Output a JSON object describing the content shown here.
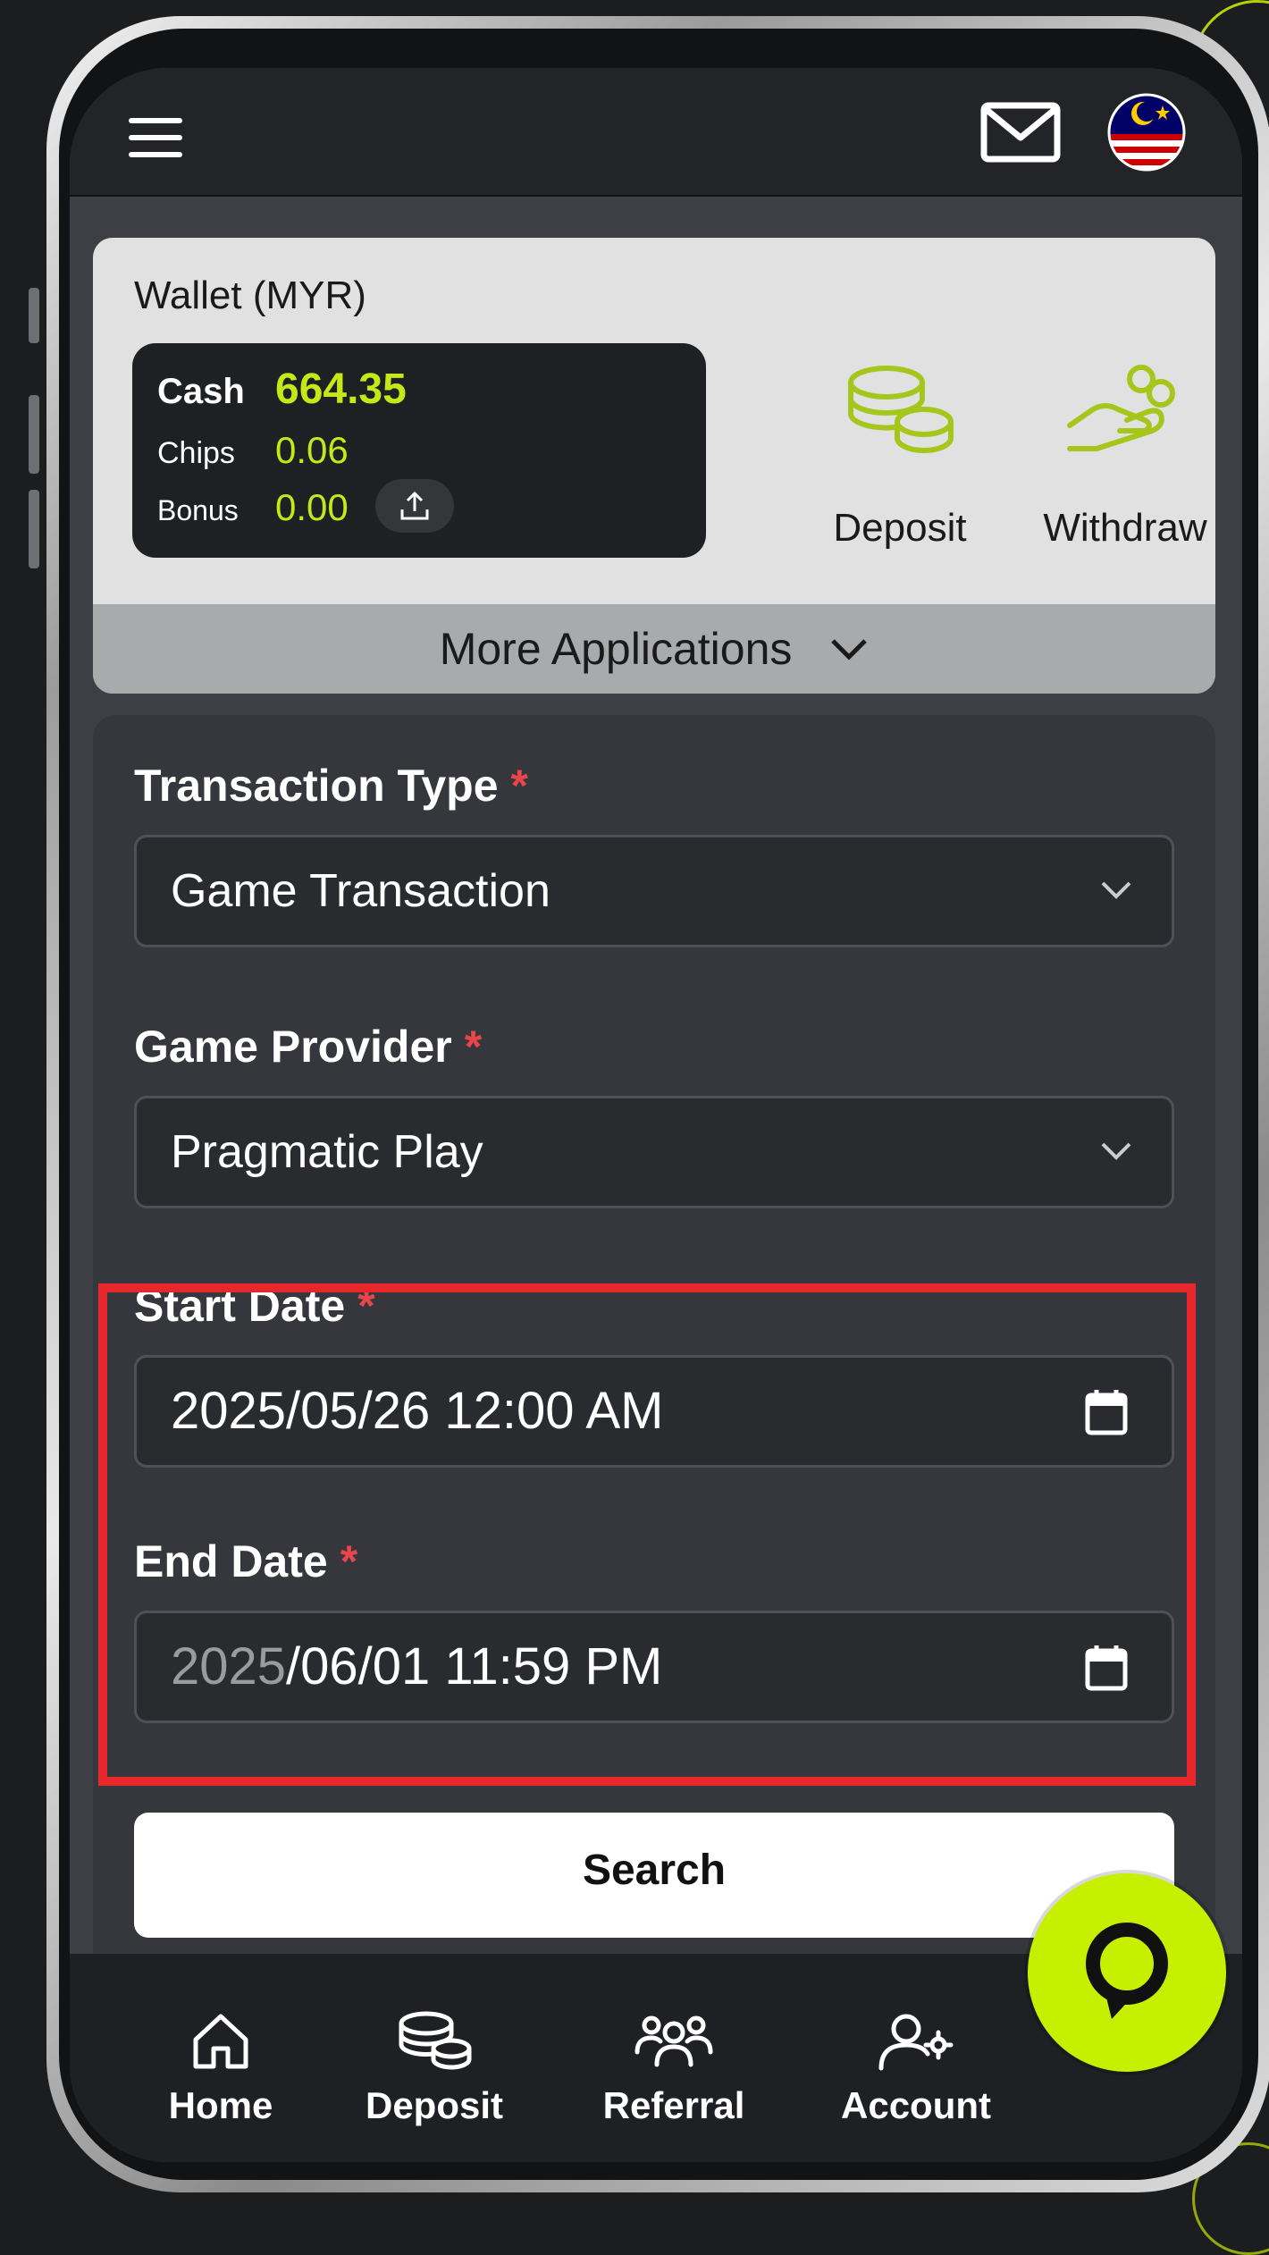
{
  "wallet": {
    "title": "Wallet (MYR)",
    "cash_label": "Cash",
    "cash_value": "664.35",
    "chips_label": "Chips",
    "chips_value": "0.06",
    "bonus_label": "Bonus",
    "bonus_value": "0.00",
    "deposit_label": "Deposit",
    "withdraw_label": "Withdraw",
    "more_apps_label": "More Applications"
  },
  "form": {
    "transaction_type": {
      "label": "Transaction Type",
      "value": "Game Transaction"
    },
    "game_provider": {
      "label": "Game Provider",
      "value": "Pragmatic Play"
    },
    "start_date": {
      "label": "Start Date",
      "value": "2025/05/26 12:00 AM"
    },
    "end_date": {
      "label": "End Date",
      "value_year": "2025",
      "value_rest": "/06/01 11:59 PM"
    },
    "required_marker": "*",
    "search_label": "Search"
  },
  "nav": {
    "home": "Home",
    "deposit": "Deposit",
    "referral": "Referral",
    "account": "Account"
  },
  "icons": {
    "menu": "hamburger-menu-icon",
    "mail": "mail-icon",
    "flag": "malaysia-flag-icon",
    "upload": "upload-icon",
    "coins": "coins-icon",
    "hand": "hand-coin-icon",
    "chevron": "chevron-down-icon",
    "calendar": "calendar-icon",
    "chat": "chat-bubble-icon"
  },
  "colors": {
    "accent": "#c5e816",
    "highlight": "#e8272d",
    "required": "#e8464b",
    "chat_fab": "#c7ef00"
  }
}
